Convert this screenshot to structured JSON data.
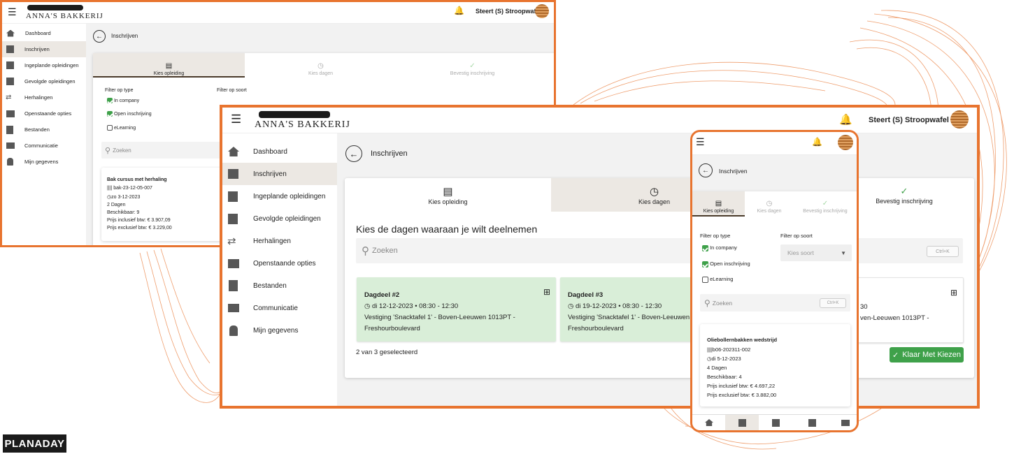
{
  "brand": {
    "logo_text": "ANNA'S BAKKERIJ",
    "user_name": "Steert (S) Stroopwafel",
    "footer_logo": "PLANADAY",
    "accent_color": "#e8742f",
    "success_color": "#3fa14a"
  },
  "nav": [
    {
      "label": "Dashboard",
      "icon": "home-icon"
    },
    {
      "label": "Inschrijven",
      "icon": "edit-icon"
    },
    {
      "label": "Ingeplande opleidingen",
      "icon": "calendar-icon"
    },
    {
      "label": "Gevolgde opleidingen",
      "icon": "book-icon"
    },
    {
      "label": "Herhalingen",
      "icon": "repeat-icon"
    },
    {
      "label": "Openstaande opties",
      "icon": "list-icon"
    },
    {
      "label": "Bestanden",
      "icon": "files-icon"
    },
    {
      "label": "Communicatie",
      "icon": "inbox-icon"
    },
    {
      "label": "Mijn gegevens",
      "icon": "user-icon"
    }
  ],
  "page_title": "Inschrijven",
  "tabs": [
    "Kies opleiding",
    "Kies dagen",
    "Bevestig inschrijving"
  ],
  "filters": {
    "type_label": "Filter op type",
    "sort_label": "Filter op soort",
    "options": [
      {
        "label": "In company",
        "checked": true
      },
      {
        "label": "Open inschrijving",
        "checked": true
      },
      {
        "label": "eLearning",
        "checked": false
      }
    ],
    "sort_placeholder": "Kies soort"
  },
  "search": {
    "placeholder": "Zoeken",
    "shortcut": "Ctrl+K"
  },
  "course_back": {
    "title": "Bak cursus met herhaling",
    "code": "bak-23-12-05-007",
    "date": "zo 3-12-2023",
    "days": "2 Dagen",
    "available": "Beschikbaar: 9",
    "price_incl": "Prijs inclusief btw: € 3.907,09",
    "price_excl": "Prijs exclusief btw: € 3.229,00"
  },
  "main": {
    "heading": "Kies de dagen waaraan je wilt deelnemen",
    "days": [
      {
        "title": "Dagdeel #2",
        "when": "di 12-12-2023 • 08:30 - 12:30",
        "location": "Vestiging 'Snacktafel 1' - Boven-Leeuwen 1013PT -",
        "street": "Freshourboulevard"
      },
      {
        "title": "Dagdeel #3",
        "when": "di 19-12-2023 • 08:30 - 12:30",
        "location": "Vestiging 'Snacktafel 1' - Boven-Leeuwen 1013PT -",
        "street": "Freshourboulevard"
      },
      {
        "when_tail": "30",
        "location_tail": "ven-Leeuwen 1013PT -"
      }
    ],
    "selected_count": "2 van 3 geselecteerd",
    "done_button": "Klaar Met Kiezen"
  },
  "mobile_course": {
    "title": "Oliebollernbakken wedstrijd",
    "code": "b06-202311-002",
    "date": "di 5-12-2023",
    "days": "4 Dagen",
    "available": "Beschikbaar: 4",
    "price_incl": "Prijs inclusief btw: € 4.697,22",
    "price_excl": "Prijs exclusief btw: € 3.882,00"
  }
}
